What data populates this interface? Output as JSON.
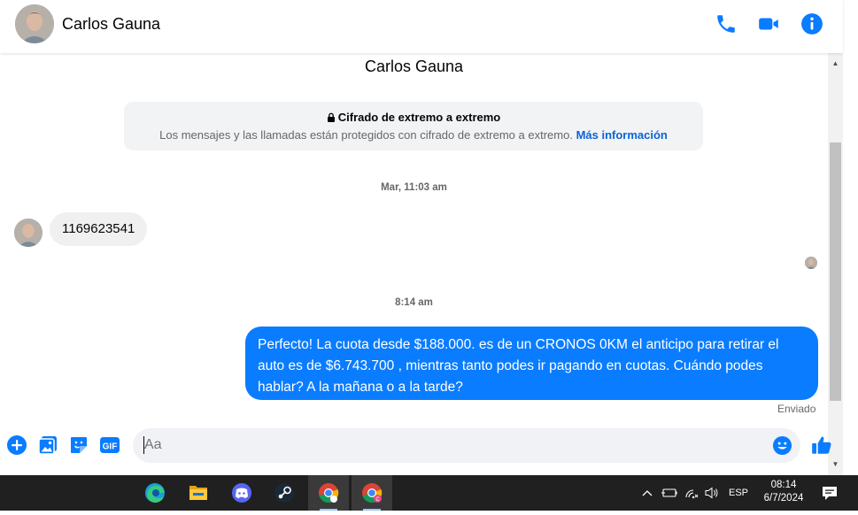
{
  "header": {
    "contact_name": "Carlos Gauna",
    "icons": [
      "phone-icon",
      "video-camera-icon",
      "info-icon"
    ]
  },
  "thread": {
    "contact_name": "Carlos Gauna",
    "e2e": {
      "title": "Cifrado de extremo a extremo",
      "description": "Los mensajes y las llamadas están protegidos con cifrado de extremo a extremo.",
      "link": "Más información"
    },
    "timestamp_1": "Mar, 11:03 am",
    "incoming_message": "1169623541",
    "timestamp_2": "8:14 am",
    "outgoing_message": "Perfecto! La cuota desde $188.000. es de un CRONOS 0KM el anticipo para retirar el auto es de $6.743.700 , mientras tanto podes ir pagando en cuotas. Cuándo podes hablar? A la mañana o a la tarde?",
    "status": "Enviado"
  },
  "composer": {
    "placeholder": "Aa",
    "icons": [
      "plus-circle-icon",
      "image-icon",
      "sticker-icon",
      "gif-icon",
      "emoji-icon",
      "thumbs-up-icon"
    ]
  },
  "taskbar": {
    "apps": [
      "edge-icon",
      "file-explorer-icon",
      "discord-icon",
      "steam-icon",
      "chrome-icon",
      "chrome-profile-icon"
    ],
    "language": "ESP",
    "time": "08:14",
    "date": "6/7/2024"
  },
  "colors": {
    "accent": "#0a7cff",
    "link": "#0a63d8",
    "taskbar": "#202020"
  }
}
